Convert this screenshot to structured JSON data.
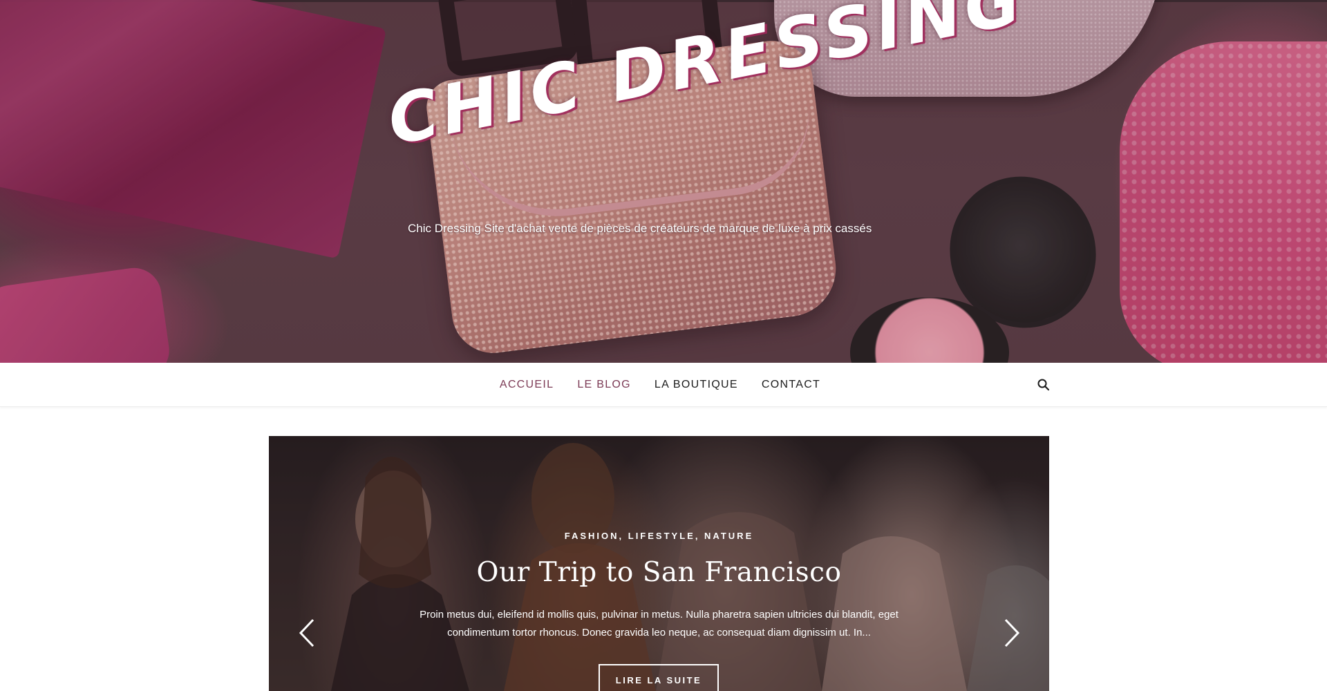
{
  "header": {
    "site_title": "CHIC DRESSING",
    "tagline": "Chic Dressing Site d'achat vente de pièces de créateurs de marque de luxe à prix cassés"
  },
  "nav": {
    "items": [
      {
        "label": "ACCUEIL",
        "active": true
      },
      {
        "label": "LE BLOG",
        "active": true
      },
      {
        "label": "LA BOUTIQUE",
        "active": false
      },
      {
        "label": "CONTACT",
        "active": false
      }
    ],
    "search_icon": "search-icon"
  },
  "slider": {
    "categories": "FASHION, LIFESTYLE, NATURE",
    "title": "Our Trip to San Francisco",
    "excerpt": "Proin metus dui, eleifend id mollis quis, pulvinar in metus. Nulla pharetra sapien ultricies dui blandit, eget condimentum tortor rhoncus. Donec gravida leo neque, ac consequat diam dignissim ut. In...",
    "button_label": "LIRE LA SUITE",
    "prev_icon": "chevron-left-icon",
    "next_icon": "chevron-right-icon"
  },
  "colors": {
    "accent": "#7c3a55",
    "nav_text": "#1b1b1b",
    "hero_bg": "#5a3b44"
  }
}
